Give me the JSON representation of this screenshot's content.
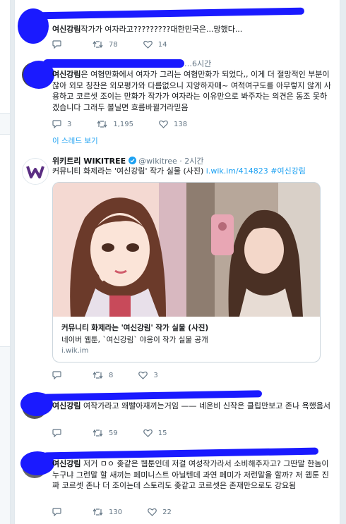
{
  "tweets": [
    {
      "body_bold": "여신강림",
      "body_rest": "작가가 여자라고?????????대한민국은...망했다...",
      "replies": "",
      "retweets": "78",
      "likes": "14"
    },
    {
      "partial_header": "…6시간",
      "body_bold": "여신강림",
      "body_rest": "은 여혐만화에서 여자가 그리는 여혐만화가 되었다,, 이게 더 절망적인 부분이잖아 외모 칭찬은 외모평가와 다름없으니 지양하자매~ 여적여구도를 아무렇지 않게 사용하고 코르셋 조이는 만화가 작가가 여자라는 이유만으로 봐주자는 의견은 동조 못하겠습니다 그래두 볼닐면 흐름바뀔거라믿음",
      "replies": "3",
      "retweets": "1,195",
      "likes": "138",
      "thread_link": "이 스레드 보기"
    },
    {
      "author_name": "위키트리 WIKITREE",
      "handle": "@wikitree",
      "time": "2시간",
      "body_text": "커뮤니티 화제라는 '여신강림' 작가 실물 (사진) ",
      "body_link": "i.wik.im/414823",
      "body_hashtag": "#여신강림",
      "card_title": "커뮤니티 화제라는 '여신강림' 작가 실물 (사진)",
      "card_desc": "네이버 웹툰, `여신강림` 야옹이 작가 실물 공개",
      "card_domain": "i.wik.im",
      "replies": "",
      "retweets": "8",
      "likes": "3"
    },
    {
      "body_bold": "여신강림",
      "body_rest": " 여작가라고 왜빨아재끼는거임 —— 네온비 신작은 클립만보고 존나 욕했음서",
      "replies": "",
      "retweets": "59",
      "likes": "15"
    },
    {
      "body_bold": "여신강림",
      "body_rest": " 저거 ㅁㅇ 좆같은 웹툰인데 저걸 여성작가라서 소비해주자고? 그딴말 한놈이 누구냐 그런말 할 새끼는 페미니스트 아닐텐데 과연 페미가 저런말을 할까? 저 웹툰 진짜 코르셋 존나 더 조이는데 스토리도 좆같고 코르셋은 존재만으로도 강요됨",
      "replies": "",
      "retweets": "130",
      "likes": "22"
    }
  ],
  "colors": {
    "accent": "#1da1f2",
    "scribble": "#1a1aff",
    "muted": "#657786",
    "wikitree_purple": "#5a2d82"
  }
}
